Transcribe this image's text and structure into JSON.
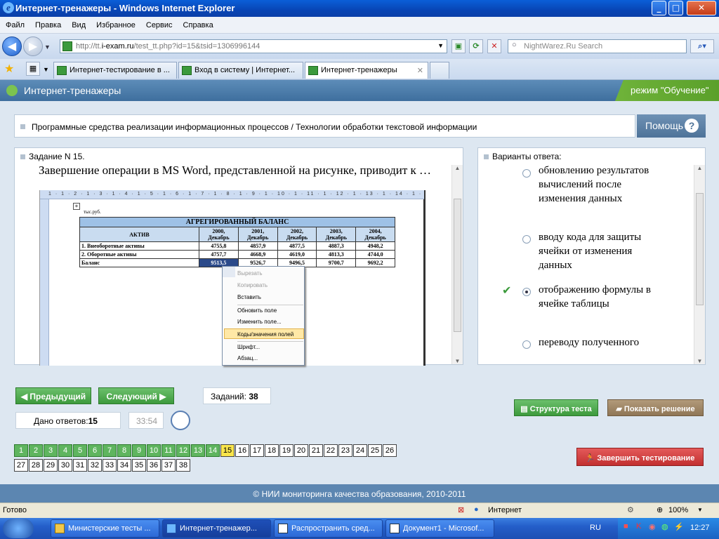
{
  "window": {
    "title": "Интернет-тренажеры - Windows Internet Explorer",
    "minimize": "_",
    "maximize": "□",
    "close": "✕"
  },
  "menu": [
    "Файл",
    "Правка",
    "Вид",
    "Избранное",
    "Сервис",
    "Справка"
  ],
  "address": {
    "prefix": "http://tt.",
    "host": "i-exam.ru",
    "path": "/test_tt.php?id=15&tsid=1306996144"
  },
  "search": {
    "placeholder": "NightWarez.Ru Search"
  },
  "tabs": [
    {
      "label": "Интернет-тестирование в ..."
    },
    {
      "label": "Вход в систему | Интернет..."
    },
    {
      "label": "Интернет-тренажеры",
      "close": "✕"
    }
  ],
  "app": {
    "title": "Интернет-тренажеры",
    "mode": "режим \"Обучение\""
  },
  "topic": "Программные средства реализации информационных процессов / Технологии обработки текстовой информации",
  "help": {
    "label": "Помощь",
    "icon": "?"
  },
  "question": {
    "header": "Задание N 15.",
    "text": "Завершение операции в MS Word, представленной на рисунке, приводит к …"
  },
  "word_image": {
    "ruler": "1 · 1 · 2 · 1 · 3 · 1 · 4 · 1 · 5 · 1 · 6 · 1 · 7 · 1 · 8 · 1 · 9 · 1 · 10 · 1 · 11 · 1 · 12 · 1 · 13 · 1 · 14 · 1 · 15 · 1 · 16 · 1 · 17 · 1",
    "unit": "тыс.руб.",
    "table_title": "АГРЕГИРОВАННЫЙ БАЛАНС",
    "col0": "АКТИВ",
    "years": [
      {
        "y": "2000,",
        "m": "Декабрь"
      },
      {
        "y": "2001,",
        "m": "Декабрь"
      },
      {
        "y": "2002,",
        "m": "Декабрь"
      },
      {
        "y": "2003,",
        "m": "Декабрь"
      },
      {
        "y": "2004,",
        "m": "Декабрь"
      }
    ],
    "rows": [
      {
        "label": "1. Внеоборотные активы",
        "vals": [
          "4755,8",
          "4857,9",
          "4877,5",
          "4887,3",
          "4948,2"
        ]
      },
      {
        "label": "2. Оборотные активы",
        "vals": [
          "4757,7",
          "4668,9",
          "4619,0",
          "4813,3",
          "4744,0"
        ]
      },
      {
        "label": "Баланс",
        "vals": [
          "9513,5",
          "9526,7",
          "9496,5",
          "9700,7",
          "9692,2"
        ]
      }
    ],
    "context_menu": [
      {
        "label": "Вырезать",
        "disabled": true
      },
      {
        "label": "Копировать",
        "disabled": true
      },
      {
        "label": "Вставить",
        "disabled": false
      },
      {
        "label": "Обновить поле",
        "disabled": false
      },
      {
        "label": "Изменить поле...",
        "disabled": false
      },
      {
        "label": "Коды/значения полей",
        "disabled": false,
        "highlight": true
      },
      {
        "label": "Шрифт...",
        "disabled": false
      },
      {
        "label": "Абзац...",
        "disabled": false
      }
    ]
  },
  "answers": {
    "header": "Варианты ответа:",
    "options": [
      {
        "text": "обновлению результатов вычислений после изменения данных",
        "selected": false,
        "correct": false
      },
      {
        "text": "вводу кода для защиты ячейки от изменения данных",
        "selected": false,
        "correct": false
      },
      {
        "text": "отображению формулы в ячейке таблицы",
        "selected": true,
        "correct": true
      },
      {
        "text": "переводу полученного",
        "selected": false,
        "correct": false
      }
    ]
  },
  "nav": {
    "prev": "Предыдущий",
    "next": "Следующий",
    "tasks_label": "Заданий:",
    "tasks_count": "38",
    "answers_label": "Дано ответов:",
    "answers_count": "15",
    "timer": "33:54",
    "structure": "Структура теста",
    "show_solution": "Показать решение",
    "finish": "Завершить тестирование"
  },
  "grid": {
    "total": 38,
    "done_through": 14,
    "current": 15
  },
  "footer": "© НИИ мониторинга качества образования, 2010-2011",
  "status": {
    "ready": "Готово",
    "zone": "Интернет",
    "zoom": "100%"
  },
  "taskbar": {
    "items": [
      "Министерские тесты ...",
      "Интернет-тренажер...",
      "Распространить сред...",
      "Документ1 - Microsof..."
    ],
    "lang": "RU",
    "time": "12:27"
  },
  "colors": {
    "done": "#5fb55f",
    "current": "#f9e54b",
    "header": "#4f7fae",
    "mode": "#62a832"
  }
}
